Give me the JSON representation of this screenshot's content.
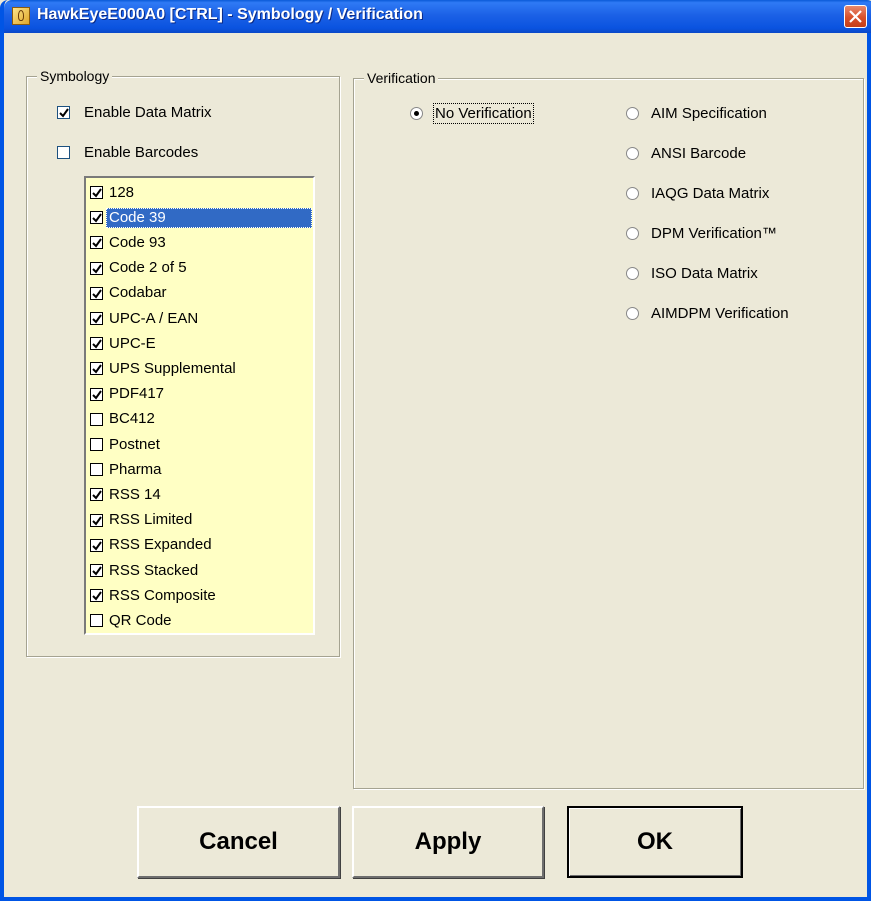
{
  "window": {
    "title": "HawkEyeE000A0 [CTRL] - Symbology / Verification",
    "titlebar_color": "#0a53e0",
    "close_color": "#d8502a"
  },
  "symbology": {
    "label": "Symbology",
    "enable_data_matrix": {
      "label": "Enable Data Matrix",
      "checked": true
    },
    "enable_barcodes": {
      "label": "Enable Barcodes",
      "checked": false
    },
    "list_bg": "#ffffc4",
    "items": [
      {
        "label": "128",
        "checked": true
      },
      {
        "label": "Code 39",
        "checked": true,
        "selected": true
      },
      {
        "label": "Code 93",
        "checked": true
      },
      {
        "label": "Code 2 of 5",
        "checked": true
      },
      {
        "label": "Codabar",
        "checked": true
      },
      {
        "label": "UPC-A / EAN",
        "checked": true
      },
      {
        "label": "UPC-E",
        "checked": true
      },
      {
        "label": "UPS Supplemental",
        "checked": true
      },
      {
        "label": "PDF417",
        "checked": true
      },
      {
        "label": "BC412",
        "checked": false
      },
      {
        "label": "Postnet",
        "checked": false
      },
      {
        "label": "Pharma",
        "checked": false
      },
      {
        "label": "RSS 14",
        "checked": true
      },
      {
        "label": "RSS Limited",
        "checked": true
      },
      {
        "label": "RSS Expanded",
        "checked": true
      },
      {
        "label": "RSS Stacked",
        "checked": true
      },
      {
        "label": "RSS Composite",
        "checked": true
      },
      {
        "label": "QR Code",
        "checked": false
      }
    ]
  },
  "verification": {
    "label": "Verification",
    "options": [
      {
        "label": "No Verification",
        "selected": true
      },
      {
        "label": "AIM Specification",
        "selected": false
      },
      {
        "label": "ANSI Barcode",
        "selected": false
      },
      {
        "label": "IAQG Data Matrix",
        "selected": false
      },
      {
        "label": "DPM Verification™",
        "selected": false
      },
      {
        "label": "ISO Data Matrix",
        "selected": false
      },
      {
        "label": "AIMDPM Verification",
        "selected": false
      }
    ]
  },
  "buttons": {
    "cancel": "Cancel",
    "apply": "Apply",
    "ok": "OK"
  }
}
